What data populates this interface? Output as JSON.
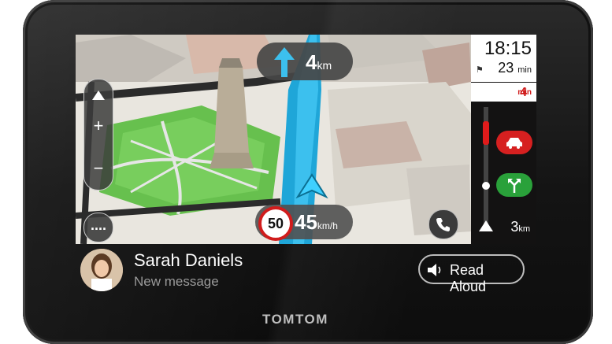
{
  "brand": "TOMTOM",
  "instruction": {
    "distance": "4",
    "unit": "km"
  },
  "eta": {
    "time": "18:15",
    "remaining": "23",
    "remaining_unit": "min",
    "delay": "4",
    "delay_unit": "min"
  },
  "speed": {
    "limit": "50",
    "current": "45",
    "unit": "km/h"
  },
  "route_bar": {
    "distance": "3",
    "unit": "km"
  },
  "notification": {
    "caller": "Sarah Daniels",
    "message": "New message",
    "action_label": "Read Aloud"
  },
  "map_controls": {
    "menu": "...."
  },
  "colors": {
    "route": "#1fa6d8",
    "traffic_red": "#d62020",
    "traffic_green": "#2aa13a",
    "delay": "#d01c1c"
  },
  "icons": [
    "up-arrow-icon",
    "zoom-in-icon",
    "zoom-out-icon",
    "tilt-up-icon",
    "menu-icon",
    "phone-icon",
    "car-icon",
    "junction-icon",
    "finish-flag-icon",
    "speaker-icon"
  ]
}
